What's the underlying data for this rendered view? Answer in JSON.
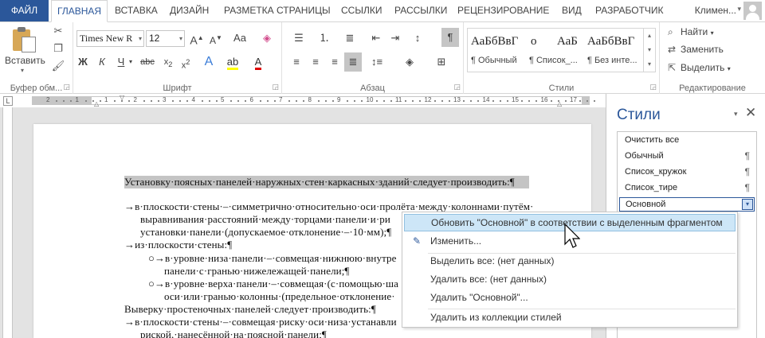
{
  "tabs": {
    "file": "ФАЙЛ",
    "items": [
      "ГЛАВНАЯ",
      "ВСТАВКА",
      "ДИЗАЙН",
      "РАЗМЕТКА СТРАНИЦЫ",
      "ССЫЛКИ",
      "РАССЫЛКИ",
      "РЕЦЕНЗИРОВАНИЕ",
      "ВИД",
      "РАЗРАБОТЧИК"
    ],
    "active": "ГЛАВНАЯ",
    "user": "Климен..."
  },
  "ribbon": {
    "clipboard": {
      "label": "Буфер обм...",
      "paste_label": "Вставить"
    },
    "font": {
      "label": "Шрифт",
      "font_name": "Times New R",
      "font_size": "12"
    },
    "paragraph": {
      "label": "Абзац"
    },
    "styles": {
      "label": "Стили",
      "gallery": [
        {
          "sample": "АаБбВвГ",
          "name": "¶ Обычный"
        },
        {
          "sample": "о",
          "name": "¶ Список_..."
        },
        {
          "sample": "АаБ",
          "name": ""
        },
        {
          "sample": "АаБбВвГ",
          "name": "¶ Без инте..."
        }
      ]
    },
    "editing": {
      "label": "Редактирование",
      "find": "Найти",
      "replace": "Заменить",
      "select": "Выделить"
    }
  },
  "ruler": {
    "numbers": [
      "2",
      "1",
      "1",
      "2",
      "3",
      "4",
      "5",
      "6",
      "7",
      "8",
      "9",
      "10",
      "11",
      "12",
      "13",
      "14",
      "15",
      "16",
      "17"
    ]
  },
  "document": {
    "lines": [
      "Установку·поясных·панелей·наружных·стен·каркасных·зданий·следует·производить:¶",
      "→в·плоскости·стены·–·симметрично·относительно·оси·пролёта·между·колоннами·путём·",
      "выравнивания·расстояний·между·торцами·панели·и·ри",
      "установки·панели·(допускаемое·отклонение·–·10·мм);¶",
      "→из·плоскости·стены:¶",
      "○→в·уровне·низа·панели·–·совмещая·нижнюю·внутре",
      "панели·с·гранью·нижележащей·панели;¶",
      "○→в·уровне·верха·панели·–·совмещая·(с·помощью·ша",
      "оси·или·гранью·колонны·(предельное·отклонение·",
      "Выверку·простеночных·панелей·следует·производить:¶",
      "→в·плоскости·стены·–·совмещая·риску·оси·низа·устанавли",
      "риской,·нанесённой·на·поясной·панели;¶"
    ]
  },
  "styles_pane": {
    "title": "Стили",
    "items": [
      {
        "label": "Очистить все",
        "mark": ""
      },
      {
        "label": "Обычный",
        "mark": "¶"
      },
      {
        "label": "Список_кружок",
        "mark": "¶"
      },
      {
        "label": "Список_тире",
        "mark": "¶"
      },
      {
        "label": "Основной",
        "mark": ""
      }
    ],
    "selected": "Основной"
  },
  "context_menu": {
    "items": [
      "Обновить \"Основной\" в соответствии с выделенным фрагментом",
      "Изменить...",
      "Выделить все: (нет данных)",
      "Удалить все: (нет данных)",
      "Удалить \"Основной\"...",
      "Удалить из коллекции стилей"
    ],
    "hovered_index": 0
  },
  "colors": {
    "accent": "#2b579a",
    "highlight": "#c4c4c4",
    "menu_hover": "#cde6f7"
  }
}
